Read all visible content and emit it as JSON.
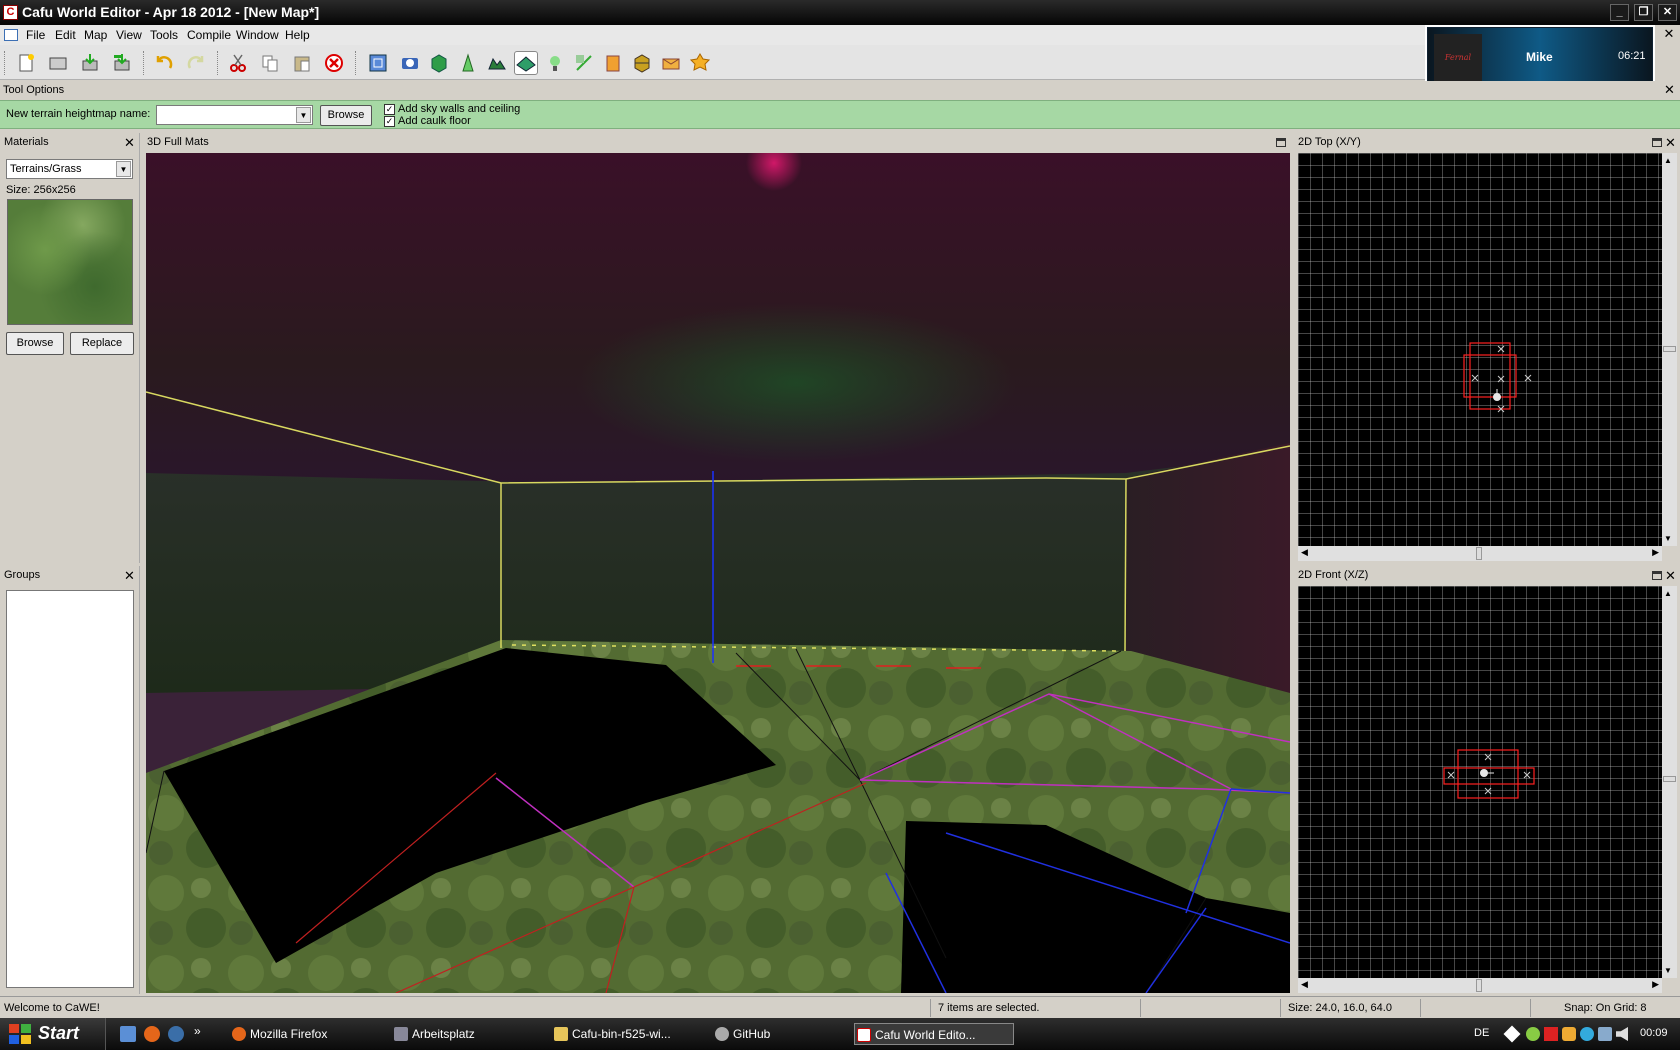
{
  "window": {
    "title": "Cafu World Editor - Apr 18 2012 - [New Map*]"
  },
  "menu": [
    "File",
    "Edit",
    "Map",
    "View",
    "Tools",
    "Compile",
    "Window",
    "Help"
  ],
  "toolbar_icons": [
    "new-file-icon",
    "open-icon",
    "save-icon",
    "save-as-icon",
    "undo-icon",
    "redo-icon",
    "cut-icon",
    "copy-icon",
    "paste-icon",
    "delete-icon",
    "selection-tool-icon",
    "camera-tool-icon",
    "new-brush-icon",
    "new-bezier-patch-icon",
    "new-terrain-icon",
    "edit-terrain-icon",
    "new-entity-icon",
    "edit-vertices-icon",
    "edit-faces-icon",
    "clip-brushes-icon",
    "place-decal-icon",
    "edit-texture-icon"
  ],
  "notification": {
    "user": "Mike",
    "time": "06:21",
    "avatar_text": "Fernal Emergence"
  },
  "tool_options": {
    "header": "Tool Options",
    "heightmap_label": "New terrain heightmap name:",
    "heightmap_value": "",
    "browse_label": "Browse",
    "sky_walls_label": "Add sky walls and ceiling",
    "sky_walls_checked": true,
    "caulk_label": "Add caulk floor",
    "caulk_checked": true
  },
  "materials": {
    "header": "Materials",
    "selected": "Terrains/Grass",
    "size_text": "Size: 256x256",
    "browse_label": "Browse",
    "replace_label": "Replace"
  },
  "groups": {
    "header": "Groups"
  },
  "views": {
    "view3d_title": "3D Full Mats",
    "top_title": "2D Top (X/Y)",
    "front_title": "2D Front (X/Z)"
  },
  "status": {
    "welcome": "Welcome to CaWE!",
    "selection": "7 items are selected.",
    "size": "Size: 24.0, 16.0, 64.0",
    "snap": "Snap: On  Grid: 8"
  },
  "taskbar": {
    "start_label": "Start",
    "tasks": [
      "Mozilla Firefox",
      "Arbeitsplatz",
      "Cafu-bin-r525-wi...",
      "GitHub",
      "Cafu World Edito..."
    ],
    "lang": "DE",
    "clock": "00:09"
  },
  "colors": {
    "tool_options_bg": "#a6d8a4",
    "viewport_bg": "#000000",
    "accent_selection": "#ff2020"
  }
}
